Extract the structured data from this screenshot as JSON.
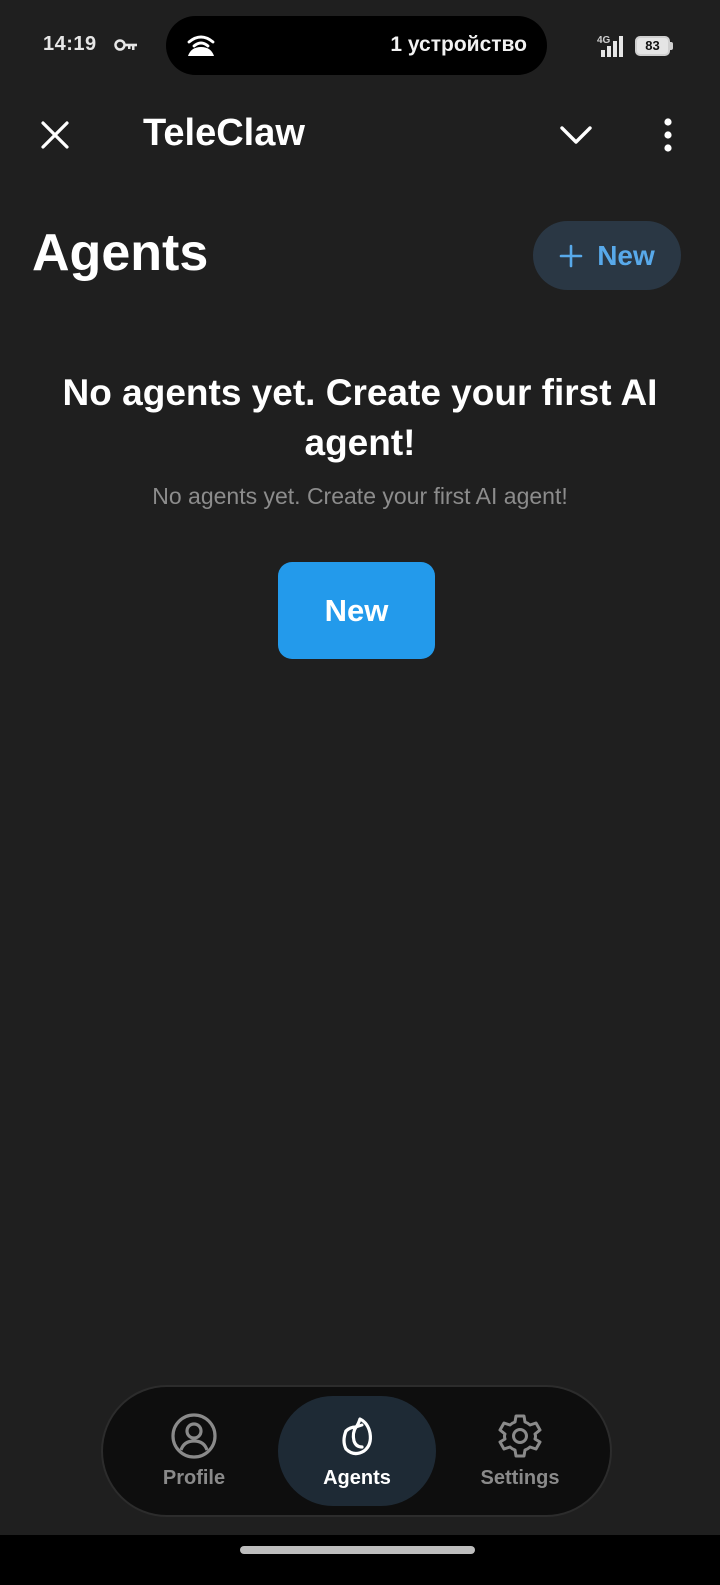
{
  "status_bar": {
    "time": "14:19",
    "island_text": "1 устройство",
    "network": "4G",
    "battery": "83",
    "icons": [
      "key-icon",
      "hotspot-icon",
      "signal-icon",
      "battery-icon"
    ]
  },
  "app_bar": {
    "title": "TeleClaw",
    "icons": [
      "close-icon",
      "chevron-down-icon",
      "more-vert-icon"
    ]
  },
  "page": {
    "title": "Agents",
    "new_pill_label": "New"
  },
  "empty_state": {
    "title": "No agents yet. Create your first AI agent!",
    "subtitle": "No agents yet. Create your first AI agent!",
    "button_label": "New"
  },
  "bottom_nav": {
    "items": [
      {
        "label": "Profile",
        "icon": "profile-icon",
        "active": false
      },
      {
        "label": "Agents",
        "icon": "agents-icon",
        "active": true
      },
      {
        "label": "Settings",
        "icon": "settings-icon",
        "active": false
      }
    ]
  },
  "colors": {
    "background": "#1f1f1f",
    "accent": "#239aeb",
    "pill_bg": "#2a3744",
    "pill_text": "#58a9ea",
    "nav_bg": "#0e0e0e",
    "nav_active_bg": "#1e2a35"
  }
}
